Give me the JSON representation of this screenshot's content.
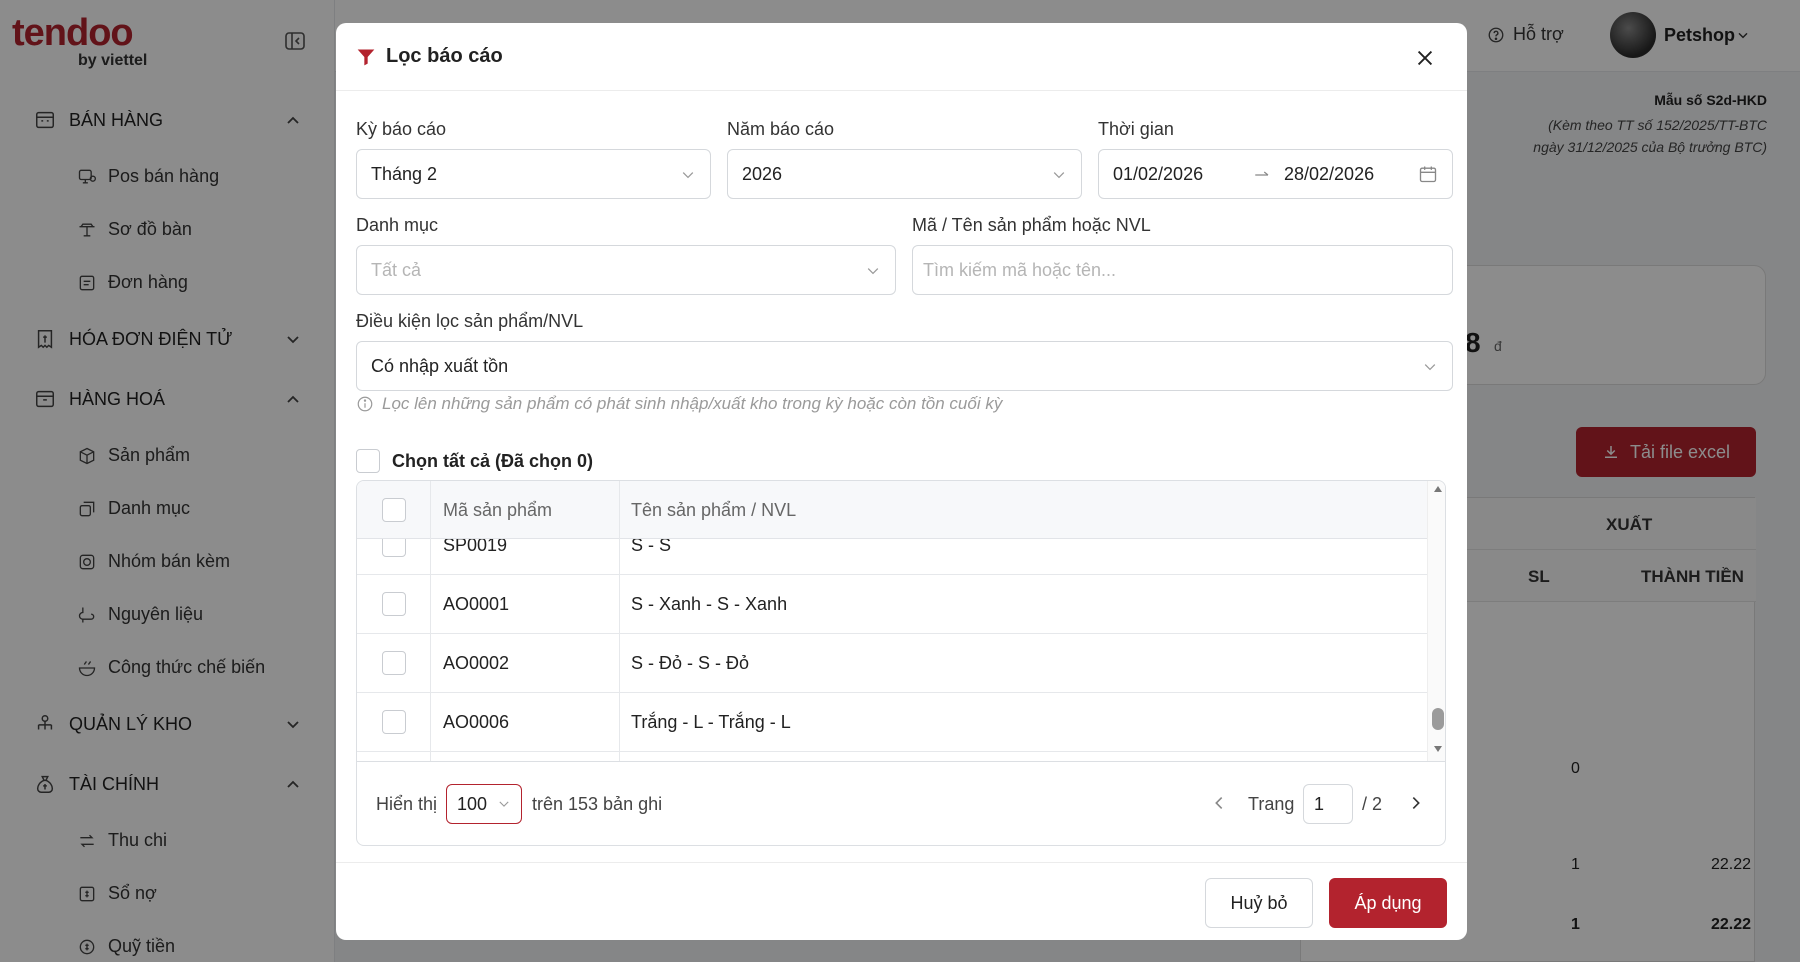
{
  "brand": {
    "name": "tendoo",
    "sub": "by viettel",
    "color": "#b3232e"
  },
  "sidebar": {
    "groups": [
      {
        "label": "BÁN HÀNG",
        "icon": "store-icon",
        "items": [
          "Pos bán hàng",
          "Sơ đồ bàn",
          "Đơn hàng"
        ]
      },
      {
        "label": "HÓA ĐƠN ĐIỆN TỬ",
        "icon": "invoice-icon",
        "items": []
      },
      {
        "label": "HÀNG HOÁ",
        "icon": "box-icon",
        "items": [
          "Sản phẩm",
          "Danh mục",
          "Nhóm bán kèm",
          "Nguyên liệu",
          "Công thức chế biến"
        ]
      },
      {
        "label": "QUẢN LÝ KHO",
        "icon": "warehouse-icon",
        "items": []
      },
      {
        "label": "TÀI CHÍNH",
        "icon": "money-bag-icon",
        "items": [
          "Thu chi",
          "Sổ nợ",
          "Quỹ tiền"
        ]
      }
    ]
  },
  "header": {
    "support": "Hỗ trợ",
    "user": "Petshop"
  },
  "background": {
    "form_code": "Mẫu số S2d-HKD",
    "form_note1": "(Kèm theo TT số 152/2025/TT-BTC",
    "form_note2": "ngày 31/12/2025 của Bộ trưởng BTC)",
    "card_value": "8",
    "card_unit": "đ",
    "excel_button": "Tải file excel",
    "col_xuat": "XUẤT",
    "col_sl": "SL",
    "col_thanh_tien": "THÀNH TIỀN",
    "val_0": "0",
    "val_1a": "1",
    "val_2222a": "22.22",
    "val_1b": "1",
    "val_2222b": "22.22"
  },
  "modal": {
    "title": "Lọc báo cáo",
    "ky_bao_cao": {
      "label": "Kỳ báo cáo",
      "value": "Tháng 2"
    },
    "nam_bao_cao": {
      "label": "Năm báo cáo",
      "value": "2026"
    },
    "thoi_gian": {
      "label": "Thời gian",
      "from": "01/02/2026",
      "to": "28/02/2026"
    },
    "danh_muc": {
      "label": "Danh mục",
      "placeholder": "Tất cả"
    },
    "ma_ten": {
      "label": "Mã / Tên sản phẩm hoặc NVL",
      "placeholder": "Tìm kiếm mã hoặc tên..."
    },
    "dieu_kien": {
      "label": "Điều kiện lọc sản phẩm/NVL",
      "value": "Có nhập xuất tồn"
    },
    "hint": "Lọc lên những sản phẩm có phát sinh nhập/xuất kho trong kỳ hoặc còn tồn cuối kỳ",
    "select_all": "Chọn tất cả (Đã chọn 0)",
    "table": {
      "headers": [
        "Mã sản phẩm",
        "Tên sản phẩm / NVL"
      ],
      "rows": [
        {
          "code": "SP0019",
          "name": "S - S"
        },
        {
          "code": "AO0001",
          "name": "S - Xanh - S - Xanh"
        },
        {
          "code": "AO0002",
          "name": "S - Đỏ - S - Đỏ"
        },
        {
          "code": "AO0006",
          "name": "Trắng - L - Trắng - L"
        }
      ]
    },
    "pagination": {
      "show_label": "Hiển thị",
      "page_size": "100",
      "total_label": "trên 153 bản ghi",
      "page_label": "Trang",
      "page": "1",
      "total_pages": "/ 2"
    },
    "cancel": "Huỷ bỏ",
    "apply": "Áp dụng"
  }
}
